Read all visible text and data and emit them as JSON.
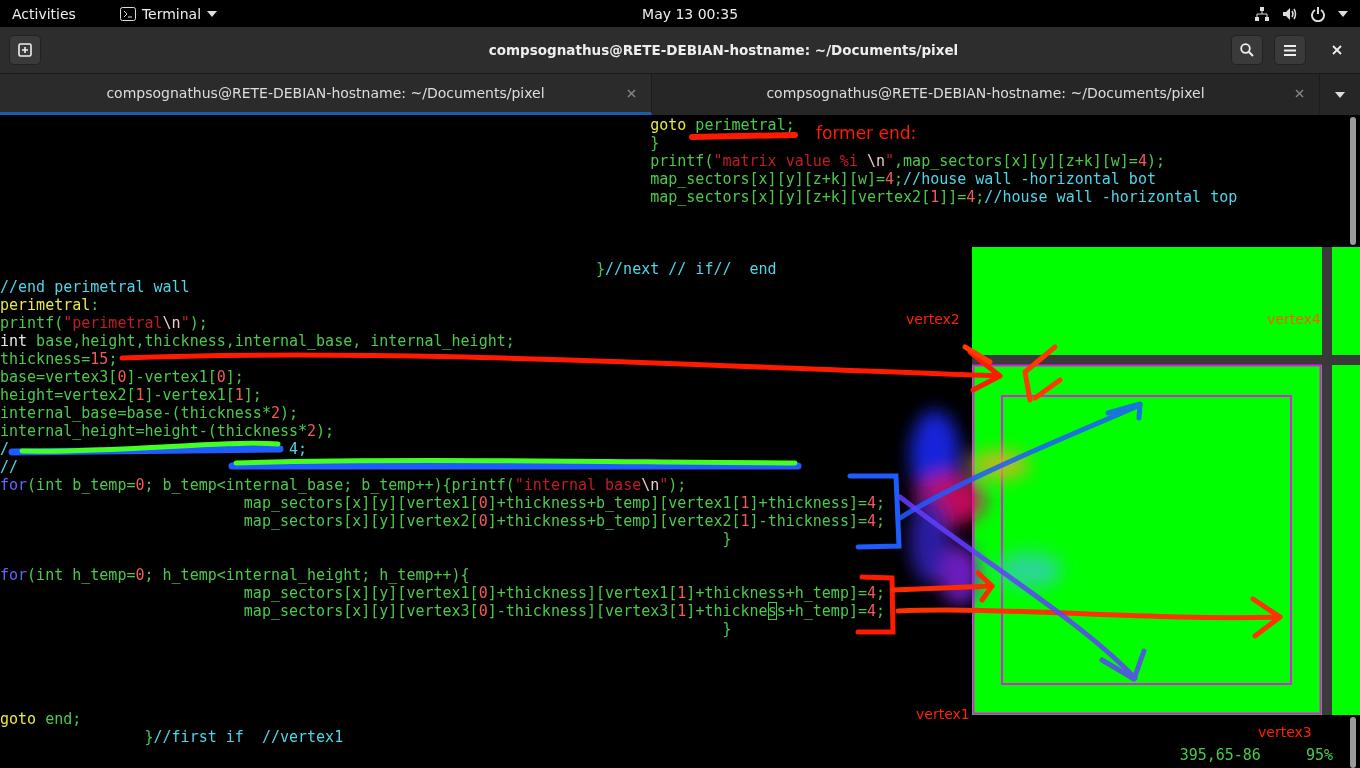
{
  "top_bar": {
    "activities": "Activities",
    "app_menu": "Terminal",
    "clock": "May 13  00:35"
  },
  "window": {
    "title": "compsognathus@RETE-DEBIAN-hostname: ~/Documents/pixel"
  },
  "tabs": [
    {
      "label": "compsognathus@RETE-DEBIAN-hostname: ~/Documents/pixel",
      "selected": true
    },
    {
      "label": "compsognathus@RETE-DEBIAN-hostname: ~/Documents/pixel",
      "selected": false
    }
  ],
  "editor": {
    "lines": [
      {
        "kind": "code",
        "tokens": [
          {
            "text": "                                                                        goto",
            "kind": "label"
          },
          {
            "text": " perimetral;",
            "kind": "plain"
          }
        ]
      },
      {
        "kind": "code",
        "tokens": [
          {
            "text": "                                                                        }",
            "kind": "plain"
          }
        ]
      },
      {
        "kind": "code",
        "tokens": [
          {
            "text": "                                                                        printf(",
            "kind": "plain"
          },
          {
            "text": "\"matrix value %i ",
            "kind": "string"
          },
          {
            "text": "\\n",
            "kind": "special"
          },
          {
            "text": "\"",
            "kind": "string"
          },
          {
            "text": ",map_sectors[x][y][z+k][w]=",
            "kind": "plain"
          },
          {
            "text": "4",
            "kind": "number"
          },
          {
            "text": ");",
            "kind": "plain"
          }
        ]
      },
      {
        "kind": "code",
        "tokens": [
          {
            "text": "                                                                        map_sectors[x][y][z+k][w]=",
            "kind": "plain"
          },
          {
            "text": "4",
            "kind": "number"
          },
          {
            "text": ";",
            "kind": "plain"
          },
          {
            "text": "//house wall -horizontal bot",
            "kind": "comment"
          }
        ]
      },
      {
        "kind": "code",
        "tokens": [
          {
            "text": "                                                                        map_sectors[x][y][z+k][vertex2[",
            "kind": "plain"
          },
          {
            "text": "1",
            "kind": "number"
          },
          {
            "text": "]]=",
            "kind": "plain"
          },
          {
            "text": "4",
            "kind": "number"
          },
          {
            "text": ";",
            "kind": "plain"
          },
          {
            "text": "//house wall -horizontal top",
            "kind": "comment"
          }
        ]
      },
      {
        "kind": "blank"
      },
      {
        "kind": "blank"
      },
      {
        "kind": "blank"
      },
      {
        "kind": "code",
        "tokens": [
          {
            "text": "                                                                  }",
            "kind": "plain"
          },
          {
            "text": "//next // if//  end",
            "kind": "comment"
          }
        ]
      },
      {
        "kind": "code",
        "tokens": [
          {
            "text": "//end perimetral wall",
            "kind": "comment"
          }
        ]
      },
      {
        "kind": "code",
        "tokens": [
          {
            "text": "perimetral",
            "kind": "label"
          },
          {
            "text": ":",
            "kind": "plain"
          }
        ]
      },
      {
        "kind": "code",
        "tokens": [
          {
            "text": "printf(",
            "kind": "plain"
          },
          {
            "text": "\"perimetral",
            "kind": "string"
          },
          {
            "text": "\\n",
            "kind": "special"
          },
          {
            "text": "\"",
            "kind": "string"
          },
          {
            "text": ");",
            "kind": "plain"
          }
        ]
      },
      {
        "kind": "code",
        "tokens": [
          {
            "text": "int",
            "kind": "type"
          },
          {
            "text": " base,height,thickness,internal_base, internal_height;",
            "kind": "plain"
          }
        ]
      },
      {
        "kind": "code",
        "tokens": [
          {
            "text": "thickness=",
            "kind": "plain"
          },
          {
            "text": "15",
            "kind": "number"
          },
          {
            "text": ";",
            "kind": "plain"
          }
        ]
      },
      {
        "kind": "code",
        "tokens": [
          {
            "text": "base=vertex3[",
            "kind": "plain"
          },
          {
            "text": "0",
            "kind": "number"
          },
          {
            "text": "]-vertex1[",
            "kind": "plain"
          },
          {
            "text": "0",
            "kind": "number"
          },
          {
            "text": "];",
            "kind": "plain"
          }
        ]
      },
      {
        "kind": "code",
        "tokens": [
          {
            "text": "height=vertex2[",
            "kind": "plain"
          },
          {
            "text": "1",
            "kind": "number"
          },
          {
            "text": "]-vertex1[",
            "kind": "plain"
          },
          {
            "text": "1",
            "kind": "number"
          },
          {
            "text": "];",
            "kind": "plain"
          }
        ]
      },
      {
        "kind": "code",
        "tokens": [
          {
            "text": "internal_base=base-(thickness*",
            "kind": "plain"
          },
          {
            "text": "2",
            "kind": "number"
          },
          {
            "text": ");",
            "kind": "plain"
          }
        ]
      },
      {
        "kind": "code",
        "tokens": [
          {
            "text": "internal_height=height-(thickness*",
            "kind": "plain"
          },
          {
            "text": "2",
            "kind": "number"
          },
          {
            "text": ");",
            "kind": "plain"
          }
        ]
      },
      {
        "kind": "code",
        "tokens": [
          {
            "text": "/",
            "kind": "comment"
          },
          {
            "text": "                               4;",
            "kind": "comment"
          }
        ]
      },
      {
        "kind": "code",
        "tokens": [
          {
            "text": "//",
            "kind": "comment"
          }
        ]
      },
      {
        "kind": "code",
        "tokens": [
          {
            "text": "for",
            "kind": "control"
          },
          {
            "text": "(int b_temp=",
            "kind": "plain"
          },
          {
            "text": "0",
            "kind": "number"
          },
          {
            "text": "; b_temp<internal_base; b_temp++){printf(",
            "kind": "plain"
          },
          {
            "text": "\"internal base",
            "kind": "string"
          },
          {
            "text": "\\n",
            "kind": "special"
          },
          {
            "text": "\"",
            "kind": "string"
          },
          {
            "text": ");",
            "kind": "plain"
          }
        ]
      },
      {
        "kind": "code",
        "tokens": [
          {
            "text": "                           map_sectors[x][y][vertex1[",
            "kind": "plain"
          },
          {
            "text": "0",
            "kind": "number"
          },
          {
            "text": "]+thickness+b_temp][vertex1[",
            "kind": "plain"
          },
          {
            "text": "1",
            "kind": "number"
          },
          {
            "text": "]+thickness]=",
            "kind": "plain"
          },
          {
            "text": "4",
            "kind": "number"
          },
          {
            "text": ";",
            "kind": "plain"
          }
        ]
      },
      {
        "kind": "code",
        "tokens": [
          {
            "text": "                           map_sectors[x][y][vertex2[",
            "kind": "plain"
          },
          {
            "text": "0",
            "kind": "number"
          },
          {
            "text": "]+thickness+b_temp][vertex2[",
            "kind": "plain"
          },
          {
            "text": "1",
            "kind": "number"
          },
          {
            "text": "]-thickness]=",
            "kind": "plain"
          },
          {
            "text": "4",
            "kind": "number"
          },
          {
            "text": ";",
            "kind": "plain"
          }
        ]
      },
      {
        "kind": "code",
        "tokens": [
          {
            "text": "                                                                                }",
            "kind": "plain"
          }
        ]
      },
      {
        "kind": "blank"
      },
      {
        "kind": "code",
        "tokens": [
          {
            "text": "for",
            "kind": "control"
          },
          {
            "text": "(int h_temp=",
            "kind": "plain"
          },
          {
            "text": "0",
            "kind": "number"
          },
          {
            "text": "; h_temp<internal_height; h_temp++){",
            "kind": "plain"
          }
        ]
      },
      {
        "kind": "code",
        "tokens": [
          {
            "text": "                           map_sectors[x][y][vertex1[",
            "kind": "plain"
          },
          {
            "text": "0",
            "kind": "number"
          },
          {
            "text": "]+thickness][vertex1[",
            "kind": "plain"
          },
          {
            "text": "1",
            "kind": "number"
          },
          {
            "text": "]+thickness+h_temp]=",
            "kind": "plain"
          },
          {
            "text": "4",
            "kind": "number"
          },
          {
            "text": ";",
            "kind": "plain"
          }
        ]
      },
      {
        "kind": "code",
        "tokens": [
          {
            "text": "                           map_sectors[x][y][vertex3[",
            "kind": "plain"
          },
          {
            "text": "0",
            "kind": "number"
          },
          {
            "text": "]-thickness][vertex3[",
            "kind": "plain"
          },
          {
            "text": "1",
            "kind": "number"
          },
          {
            "text": "]+thickne",
            "kind": "plain"
          },
          {
            "text": "s",
            "kind": "cursor"
          },
          {
            "text": "s+h_temp]=",
            "kind": "plain"
          },
          {
            "text": "4",
            "kind": "number"
          },
          {
            "text": ";",
            "kind": "plain"
          }
        ]
      },
      {
        "kind": "code",
        "tokens": [
          {
            "text": "                                                                                }",
            "kind": "plain"
          }
        ]
      },
      {
        "kind": "blank"
      },
      {
        "kind": "blank"
      },
      {
        "kind": "blank"
      },
      {
        "kind": "blank"
      },
      {
        "kind": "code",
        "tokens": [
          {
            "text": "goto",
            "kind": "label"
          },
          {
            "text": " end;",
            "kind": "plain"
          }
        ]
      },
      {
        "kind": "code",
        "tokens": [
          {
            "text": "                }",
            "kind": "plain"
          },
          {
            "text": "//first if  //vertex1",
            "kind": "comment"
          }
        ]
      }
    ],
    "status": {
      "position": "395,65-86",
      "scroll": "95%"
    }
  },
  "annotations": {
    "note": "former end:",
    "vertex_labels": [
      "vertex2",
      "vertex4",
      "vertex1",
      "vertex3"
    ]
  }
}
